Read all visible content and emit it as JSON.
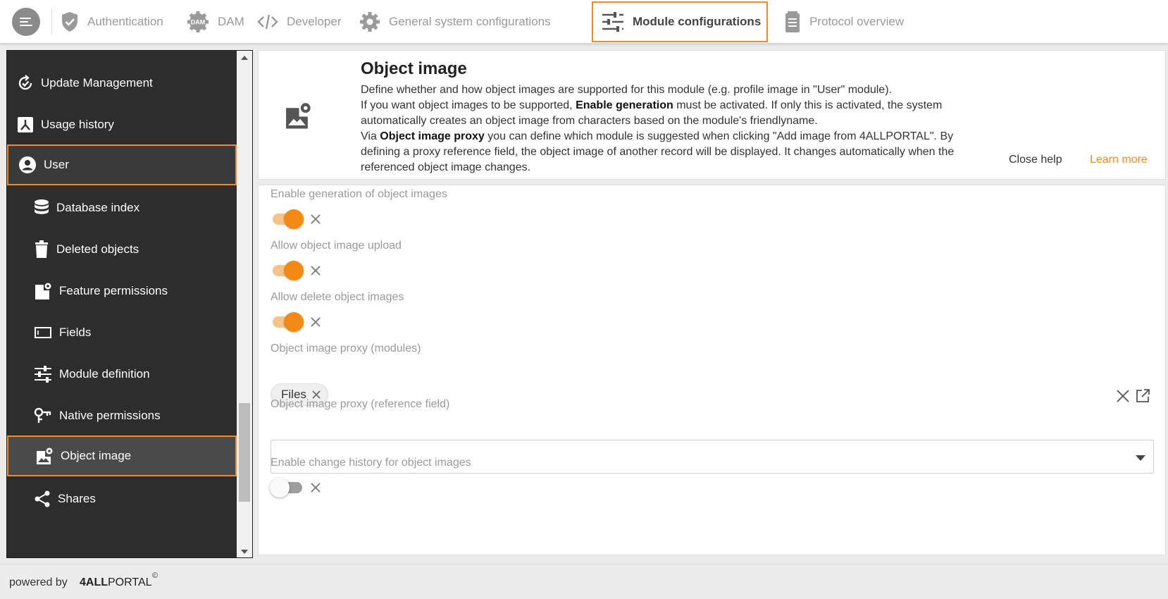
{
  "topnav": {
    "tabs": [
      {
        "label": "Authentication",
        "icon": "shield-check-icon"
      },
      {
        "label": "DAM",
        "icon": "dam-gear-icon",
        "icon_text": "DAM"
      },
      {
        "label": "Developer",
        "icon": "code-icon"
      },
      {
        "label": "General system configurations",
        "icon": "gear-icon"
      },
      {
        "label": "Module configurations",
        "icon": "sliders-icon",
        "active": true
      },
      {
        "label": "Protocol overview",
        "icon": "document-icon"
      }
    ]
  },
  "sidebar": {
    "items": [
      {
        "label": "Update Management",
        "icon": "update-check-icon"
      },
      {
        "label": "Usage history",
        "icon": "usage-history-icon"
      },
      {
        "label": "User",
        "icon": "user-circle-icon",
        "highlighted": true
      },
      {
        "label": "Database index",
        "icon": "database-icon"
      },
      {
        "label": "Deleted objects",
        "icon": "trash-icon"
      },
      {
        "label": "Feature permissions",
        "icon": "feature-permissions-icon"
      },
      {
        "label": "Fields",
        "icon": "field-icon"
      },
      {
        "label": "Module definition",
        "icon": "sliders-icon"
      },
      {
        "label": "Native permissions",
        "icon": "key-icon"
      },
      {
        "label": "Object image",
        "icon": "object-image-icon",
        "selected": true
      },
      {
        "label": "Shares",
        "icon": "share-icon"
      }
    ]
  },
  "help": {
    "title": "Object image",
    "line1": "Define whether and how object images are supported for this module (e.g. profile image in \"User\" module).",
    "line2_pre": "If you want object images to be supported, ",
    "line2_bold": "Enable generation",
    "line2_post": " must be activated. If only this is activated, the system automatically creates an object image from characters based on the module's friendlyname.",
    "line3_pre": "Via ",
    "line3_bold": "Object image proxy",
    "line3_post": " you can define which module is suggested when clicking \"Add image from 4ALLPORTAL\". By defining a proxy reference field, the object image of another record will be displayed. It changes automatically when the referenced object image changes.",
    "close_label": "Close help",
    "learn_more_label": "Learn more"
  },
  "form": {
    "enable_generation": {
      "label": "Enable generation of object images",
      "value": true
    },
    "allow_upload": {
      "label": "Allow object image upload",
      "value": true
    },
    "allow_delete": {
      "label": "Allow delete object images",
      "value": true
    },
    "proxy_modules": {
      "label": "Object image proxy (modules)",
      "chips": [
        "Files"
      ]
    },
    "proxy_reference": {
      "label": "Object image proxy (reference field)",
      "value": ""
    },
    "change_history": {
      "label": "Enable change history for object images",
      "value": false
    }
  },
  "footer": {
    "powered_by": "powered by",
    "brand_bold": "4ALL",
    "brand_rest": "PORTAL",
    "copyright": "©"
  },
  "colors": {
    "accent": "#f08a2a",
    "toggle_on": "#f38a14",
    "sidebar_bg": "#2d2d2d"
  }
}
